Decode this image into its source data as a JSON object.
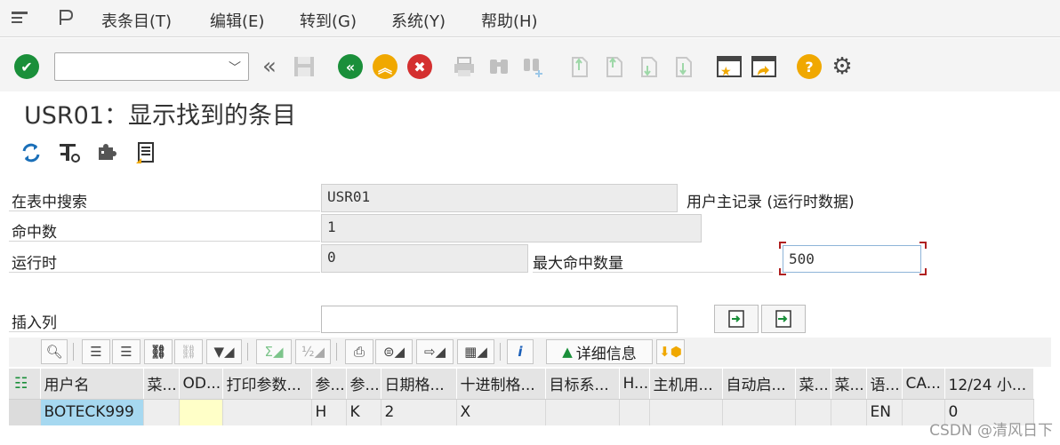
{
  "menu": {
    "items": [
      "表条目(T)",
      "编辑(E)",
      "转到(G)",
      "系统(Y)",
      "帮助(H)"
    ]
  },
  "command_field": {
    "value": ""
  },
  "title": "USR01：显示找到的条目",
  "form": {
    "search_in_table_label": "在表中搜索",
    "search_in_table_value": "USR01",
    "table_description": "用户主记录 (运行时数据)",
    "hits_label": "命中数",
    "hits_value": "1",
    "runtime_label": "运行时",
    "runtime_value": "0",
    "max_hits_label": "最大命中数量",
    "max_hits_value": "500",
    "insert_column_label": "插入列",
    "insert_column_value": ""
  },
  "grid_toolbar": {
    "detail_label": "详细信息"
  },
  "table": {
    "columns": [
      "用户名",
      "菜...",
      "OD...",
      "打印参数...",
      "参...",
      "参...",
      "日期格...",
      "十进制格...",
      "目标系...",
      "H...",
      "主机用...",
      "自动启...",
      "菜...",
      "菜...",
      "语...",
      "CA...",
      "12/24 小..."
    ],
    "rows": [
      [
        "BOTECK999",
        "",
        "",
        "",
        "H",
        "K",
        "2",
        "X",
        "",
        "",
        "",
        "",
        "",
        "",
        "EN",
        "",
        "0"
      ]
    ]
  },
  "watermark": "CSDN @清风日下",
  "colors": {
    "green": "#1a8f3a",
    "yellow": "#f0a800",
    "red": "#d43030",
    "selected_cell": "#a6d8f0",
    "highlight_cell": "#ffffc8"
  }
}
